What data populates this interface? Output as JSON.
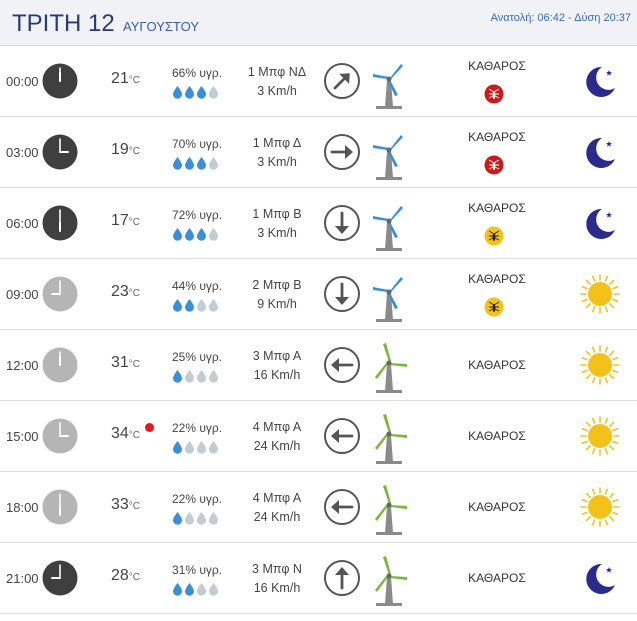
{
  "header": {
    "day": "ΤΡΙΤΗ 12",
    "month": "ΑΥΓΟΥΣΤΟΥ",
    "sunrise_label": "Ανατολή: 06:42",
    "separator": " - ",
    "sunset_label": "Δύση 20:37"
  },
  "temp_unit": "°C",
  "colors": {
    "title": "#2a3a78",
    "accent": "#3a6ab8",
    "drop_full": "#3c8fd6",
    "drop_empty": "#c3cbd3",
    "moon": "#2b2b8c",
    "sun": "#f2c21b",
    "hot_marker": "#e8151b",
    "bug_red": "#cc1a1a",
    "bug_yellow": "#f2c21b"
  },
  "rows": [
    {
      "time": "00:00",
      "clock_icon": "clock-night-icon",
      "temp": "21",
      "humidity": "66% υγρ.",
      "drops_filled": 3,
      "wind_force": "1 Μπφ ΝΔ",
      "wind_speed": "3 Km/h",
      "wind_arrow": "arrow-northeast-icon",
      "condition": "ΚΑΘΑΡΟΣ",
      "bug_icon": "mosquito-red-icon",
      "weather_icon": "moon-icon"
    },
    {
      "time": "03:00",
      "clock_icon": "clock-night-icon",
      "temp": "19",
      "humidity": "70% υγρ.",
      "drops_filled": 3,
      "wind_force": "1 Μπφ Δ",
      "wind_speed": "3 Km/h",
      "wind_arrow": "arrow-east-icon",
      "condition": "ΚΑΘΑΡΟΣ",
      "bug_icon": "mosquito-red-icon",
      "weather_icon": "moon-icon"
    },
    {
      "time": "06:00",
      "clock_icon": "clock-night-icon",
      "temp": "17",
      "humidity": "72% υγρ.",
      "drops_filled": 3,
      "wind_force": "1 Μπφ Β",
      "wind_speed": "3 Km/h",
      "wind_arrow": "arrow-south-icon",
      "condition": "ΚΑΘΑΡΟΣ",
      "bug_icon": "mosquito-yellow-icon",
      "weather_icon": "moon-icon"
    },
    {
      "time": "09:00",
      "clock_icon": "clock-day-icon",
      "temp": "23",
      "humidity": "44% υγρ.",
      "drops_filled": 2,
      "wind_force": "2 Μπφ Β",
      "wind_speed": "9 Km/h",
      "wind_arrow": "arrow-south-icon",
      "condition": "ΚΑΘΑΡΟΣ",
      "bug_icon": "mosquito-yellow-icon",
      "weather_icon": "sun-icon"
    },
    {
      "time": "12:00",
      "clock_icon": "clock-day-icon",
      "temp": "31",
      "humidity": "25% υγρ.",
      "drops_filled": 1,
      "wind_force": "3 Μπφ Α",
      "wind_speed": "16 Km/h",
      "wind_arrow": "arrow-west-icon",
      "condition": "ΚΑΘΑΡΟΣ",
      "bug_icon": "",
      "weather_icon": "sun-icon"
    },
    {
      "time": "15:00",
      "clock_icon": "clock-day-icon",
      "temp": "34",
      "hot": true,
      "humidity": "22% υγρ.",
      "drops_filled": 1,
      "wind_force": "4 Μπφ Α",
      "wind_speed": "24 Km/h",
      "wind_arrow": "arrow-west-icon",
      "condition": "ΚΑΘΑΡΟΣ",
      "bug_icon": "",
      "weather_icon": "sun-icon"
    },
    {
      "time": "18:00",
      "clock_icon": "clock-day-icon",
      "temp": "33",
      "humidity": "22% υγρ.",
      "drops_filled": 1,
      "wind_force": "4 Μπφ Α",
      "wind_speed": "24 Km/h",
      "wind_arrow": "arrow-west-icon",
      "condition": "ΚΑΘΑΡΟΣ",
      "bug_icon": "",
      "weather_icon": "sun-icon"
    },
    {
      "time": "21:00",
      "clock_icon": "clock-night-icon",
      "temp": "28",
      "humidity": "31% υγρ.",
      "drops_filled": 2,
      "wind_force": "3 Μπφ Ν",
      "wind_speed": "16 Km/h",
      "wind_arrow": "arrow-north-icon",
      "condition": "ΚΑΘΑΡΟΣ",
      "bug_icon": "",
      "weather_icon": "moon-icon"
    }
  ]
}
